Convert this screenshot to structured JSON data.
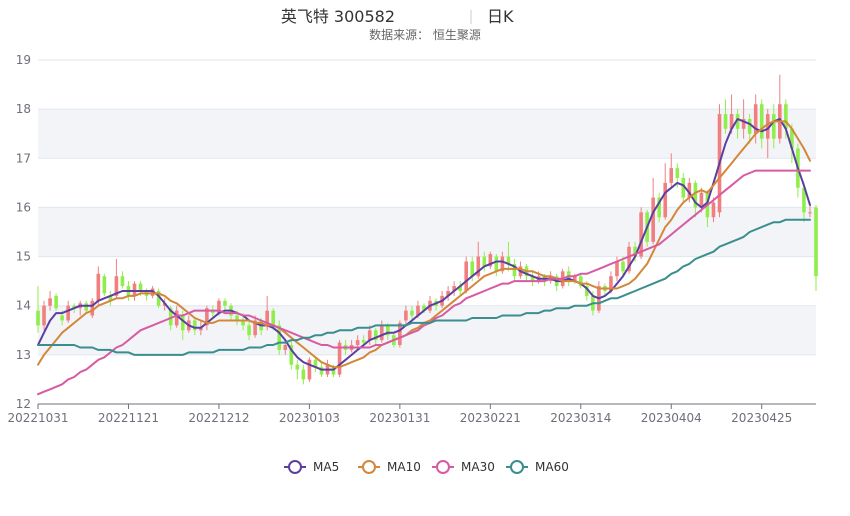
{
  "chart_data": {
    "type": "candlestick",
    "title": "英飞特 300582",
    "period_label": "日K",
    "subtitle": "数据来源： 恒生聚源",
    "ylim": [
      12,
      19
    ],
    "yticks": [
      12,
      13,
      14,
      15,
      16,
      17,
      18,
      19
    ],
    "x_tick_labels": [
      {
        "index": 0,
        "label": "20221031"
      },
      {
        "index": 15,
        "label": "20221121"
      },
      {
        "index": 30,
        "label": "20221212"
      },
      {
        "index": 45,
        "label": "20230103"
      },
      {
        "index": 60,
        "label": "20230131"
      },
      {
        "index": 75,
        "label": "20230221"
      },
      {
        "index": 90,
        "label": "20230314"
      },
      {
        "index": 105,
        "label": "20230404"
      },
      {
        "index": 120,
        "label": "20230425"
      }
    ],
    "up_color": "#F08080",
    "down_color": "#90EE4C",
    "grid": true,
    "legend_position": "bottom-center",
    "legend": [
      "MA5",
      "MA10",
      "MA30",
      "MA60"
    ],
    "candles": [
      [
        13.9,
        13.6,
        14.4,
        13.45
      ],
      [
        13.6,
        14.0,
        14.1,
        13.5
      ],
      [
        14.0,
        14.15,
        14.3,
        13.9
      ],
      [
        14.2,
        13.95,
        14.25,
        13.9
      ],
      [
        13.8,
        13.7,
        13.9,
        13.6
      ],
      [
        13.7,
        14.0,
        14.1,
        13.65
      ],
      [
        14.0,
        13.95,
        14.05,
        13.85
      ],
      [
        13.95,
        14.05,
        14.1,
        13.8
      ],
      [
        14.05,
        13.9,
        14.1,
        13.85
      ],
      [
        13.8,
        14.1,
        14.15,
        13.75
      ],
      [
        14.1,
        14.65,
        14.8,
        14.0
      ],
      [
        14.6,
        14.25,
        14.65,
        14.2
      ],
      [
        14.2,
        14.1,
        14.3,
        14.0
      ],
      [
        14.2,
        14.6,
        14.95,
        14.15
      ],
      [
        14.6,
        14.4,
        14.7,
        14.35
      ],
      [
        14.4,
        14.2,
        14.5,
        14.1
      ],
      [
        14.2,
        14.45,
        14.5,
        14.1
      ],
      [
        14.45,
        14.3,
        14.5,
        14.2
      ],
      [
        14.3,
        14.2,
        14.35,
        14.1
      ],
      [
        14.2,
        14.35,
        14.4,
        14.15
      ],
      [
        14.3,
        14.0,
        14.35,
        13.95
      ],
      [
        14.0,
        14.05,
        14.15,
        13.9
      ],
      [
        13.95,
        13.6,
        14.0,
        13.5
      ],
      [
        13.6,
        13.9,
        14.0,
        13.55
      ],
      [
        13.8,
        13.5,
        13.9,
        13.3
      ],
      [
        13.5,
        13.7,
        13.8,
        13.45
      ],
      [
        13.7,
        13.5,
        13.75,
        13.4
      ],
      [
        13.5,
        13.55,
        13.7,
        13.4
      ],
      [
        13.6,
        13.95,
        14.0,
        13.5
      ],
      [
        13.9,
        13.85,
        14.0,
        13.75
      ],
      [
        13.85,
        14.1,
        14.15,
        13.8
      ],
      [
        14.1,
        14.0,
        14.15,
        13.9
      ],
      [
        14.0,
        13.8,
        14.05,
        13.7
      ],
      [
        13.8,
        13.7,
        13.9,
        13.6
      ],
      [
        13.7,
        13.6,
        13.85,
        13.5
      ],
      [
        13.6,
        13.4,
        13.7,
        13.3
      ],
      [
        13.4,
        13.7,
        13.8,
        13.35
      ],
      [
        13.7,
        13.5,
        13.75,
        13.4
      ],
      [
        13.6,
        13.9,
        14.2,
        13.5
      ],
      [
        13.9,
        13.6,
        13.95,
        13.5
      ],
      [
        13.6,
        13.1,
        13.7,
        13.0
      ],
      [
        13.1,
        13.2,
        13.3,
        13.0
      ],
      [
        13.2,
        12.8,
        13.3,
        12.7
      ],
      [
        12.8,
        12.7,
        12.9,
        12.5
      ],
      [
        12.7,
        12.5,
        12.8,
        12.4
      ],
      [
        12.5,
        12.9,
        12.95,
        12.45
      ],
      [
        12.9,
        12.75,
        12.95,
        12.65
      ],
      [
        12.75,
        12.6,
        12.85,
        12.55
      ],
      [
        12.6,
        12.8,
        12.9,
        12.55
      ],
      [
        12.75,
        12.6,
        12.8,
        12.55
      ],
      [
        12.6,
        13.25,
        13.3,
        12.55
      ],
      [
        13.2,
        13.1,
        13.3,
        13.0
      ],
      [
        13.1,
        13.2,
        13.3,
        13.05
      ],
      [
        13.2,
        13.3,
        13.4,
        13.1
      ],
      [
        13.3,
        13.25,
        13.4,
        13.15
      ],
      [
        13.3,
        13.5,
        13.6,
        13.2
      ],
      [
        13.5,
        13.3,
        13.55,
        13.2
      ],
      [
        13.3,
        13.6,
        13.7,
        13.25
      ],
      [
        13.6,
        13.4,
        13.65,
        13.3
      ],
      [
        13.4,
        13.2,
        13.45,
        13.15
      ],
      [
        13.2,
        13.65,
        13.7,
        13.15
      ],
      [
        13.7,
        13.9,
        14.0,
        13.6
      ],
      [
        13.9,
        13.8,
        14.0,
        13.7
      ],
      [
        13.8,
        14.0,
        14.1,
        13.75
      ],
      [
        14.0,
        13.9,
        14.05,
        13.85
      ],
      [
        13.9,
        14.1,
        14.2,
        13.85
      ],
      [
        14.1,
        14.0,
        14.15,
        13.9
      ],
      [
        14.0,
        14.2,
        14.3,
        13.95
      ],
      [
        14.2,
        14.3,
        14.4,
        14.1
      ],
      [
        14.3,
        14.4,
        14.5,
        14.2
      ],
      [
        14.4,
        14.3,
        14.5,
        14.2
      ],
      [
        14.3,
        14.9,
        15.0,
        14.25
      ],
      [
        14.9,
        14.6,
        15.0,
        14.5
      ],
      [
        14.6,
        15.0,
        15.3,
        14.55
      ],
      [
        15.0,
        14.8,
        15.1,
        14.7
      ],
      [
        14.8,
        15.05,
        15.1,
        14.75
      ],
      [
        15.0,
        14.7,
        15.05,
        14.6
      ],
      [
        14.7,
        15.0,
        15.1,
        14.65
      ],
      [
        15.0,
        14.85,
        15.3,
        14.7
      ],
      [
        14.85,
        14.6,
        14.95,
        14.5
      ],
      [
        14.6,
        14.8,
        14.9,
        14.55
      ],
      [
        14.8,
        14.6,
        14.85,
        14.5
      ],
      [
        14.6,
        14.5,
        14.7,
        14.4
      ],
      [
        14.5,
        14.6,
        14.7,
        14.45
      ],
      [
        14.6,
        14.5,
        14.65,
        14.4
      ],
      [
        14.5,
        14.6,
        14.7,
        14.45
      ],
      [
        14.6,
        14.4,
        14.65,
        14.3
      ],
      [
        14.4,
        14.7,
        14.75,
        14.35
      ],
      [
        14.7,
        14.5,
        14.8,
        14.4
      ],
      [
        14.5,
        14.6,
        14.65,
        14.45
      ],
      [
        14.6,
        14.4,
        14.65,
        14.35
      ],
      [
        14.4,
        14.2,
        14.5,
        14.1
      ],
      [
        14.2,
        13.9,
        14.3,
        13.8
      ],
      [
        13.9,
        14.4,
        14.5,
        13.85
      ],
      [
        14.4,
        14.3,
        14.45,
        14.2
      ],
      [
        14.3,
        14.6,
        14.7,
        14.25
      ],
      [
        14.6,
        14.9,
        15.0,
        14.5
      ],
      [
        14.9,
        14.7,
        15.0,
        14.6
      ],
      [
        14.7,
        15.2,
        15.3,
        14.65
      ],
      [
        15.2,
        15.0,
        15.3,
        14.9
      ],
      [
        15.0,
        15.9,
        16.0,
        14.95
      ],
      [
        15.9,
        15.3,
        15.95,
        15.2
      ],
      [
        15.3,
        16.2,
        16.6,
        15.25
      ],
      [
        16.2,
        15.8,
        16.3,
        15.7
      ],
      [
        15.8,
        16.5,
        16.9,
        15.75
      ],
      [
        16.5,
        16.8,
        17.1,
        16.4
      ],
      [
        16.8,
        16.6,
        16.9,
        16.4
      ],
      [
        16.6,
        16.2,
        16.7,
        16.1
      ],
      [
        16.2,
        16.5,
        16.6,
        16.1
      ],
      [
        16.5,
        16.0,
        16.55,
        15.8
      ],
      [
        16.0,
        16.3,
        16.4,
        15.9
      ],
      [
        16.3,
        15.8,
        16.35,
        15.6
      ],
      [
        15.8,
        16.1,
        16.2,
        15.7
      ],
      [
        15.9,
        17.9,
        18.1,
        15.8
      ],
      [
        17.9,
        17.6,
        18.2,
        17.5
      ],
      [
        17.6,
        17.9,
        18.3,
        17.5
      ],
      [
        17.9,
        17.6,
        18.0,
        17.4
      ],
      [
        17.6,
        17.8,
        18.2,
        17.4
      ],
      [
        17.8,
        17.5,
        17.9,
        17.3
      ],
      [
        17.5,
        18.1,
        18.3,
        17.3
      ],
      [
        18.1,
        17.4,
        18.2,
        17.2
      ],
      [
        17.4,
        17.9,
        18.0,
        17.0
      ],
      [
        17.9,
        17.4,
        18.1,
        17.2
      ],
      [
        17.4,
        18.1,
        18.7,
        17.3
      ],
      [
        18.1,
        17.6,
        18.2,
        17.4
      ],
      [
        17.6,
        17.2,
        17.7,
        16.9
      ],
      [
        17.2,
        16.4,
        17.3,
        16.2
      ],
      [
        16.4,
        15.9,
        16.5,
        15.7
      ],
      [
        15.9,
        15.9,
        16.1,
        15.8
      ],
      [
        16.0,
        14.6,
        16.05,
        14.3
      ]
    ],
    "series": [
      {
        "name": "MA5",
        "color": "#5B3FA0",
        "values": [
          13.2,
          13.45,
          13.7,
          13.85,
          13.85,
          13.9,
          13.95,
          14.0,
          14.0,
          14.0,
          14.1,
          14.15,
          14.2,
          14.25,
          14.3,
          14.3,
          14.3,
          14.3,
          14.3,
          14.3,
          14.2,
          14.05,
          13.9,
          13.8,
          13.7,
          13.6,
          13.55,
          13.55,
          13.65,
          13.75,
          13.85,
          13.9,
          13.9,
          13.85,
          13.8,
          13.7,
          13.65,
          13.6,
          13.6,
          13.55,
          13.45,
          13.3,
          13.1,
          12.95,
          12.85,
          12.8,
          12.75,
          12.7,
          12.7,
          12.7,
          12.8,
          12.9,
          13.0,
          13.1,
          13.2,
          13.3,
          13.35,
          13.4,
          13.45,
          13.45,
          13.5,
          13.6,
          13.7,
          13.8,
          13.9,
          14.0,
          14.05,
          14.1,
          14.2,
          14.3,
          14.4,
          14.5,
          14.6,
          14.7,
          14.8,
          14.85,
          14.9,
          14.9,
          14.85,
          14.8,
          14.7,
          14.65,
          14.6,
          14.55,
          14.55,
          14.55,
          14.5,
          14.5,
          14.55,
          14.5,
          14.45,
          14.35,
          14.2,
          14.15,
          14.2,
          14.3,
          14.45,
          14.6,
          14.8,
          15.0,
          15.3,
          15.6,
          15.9,
          16.1,
          16.3,
          16.4,
          16.5,
          16.45,
          16.3,
          16.1,
          16.0,
          16.1,
          16.5,
          16.9,
          17.3,
          17.6,
          17.8,
          17.75,
          17.7,
          17.6,
          17.55,
          17.6,
          17.75,
          17.8,
          17.6,
          17.2,
          16.8,
          16.45,
          16.05
        ]
      },
      {
        "name": "MA10",
        "color": "#D4873A",
        "values": [
          12.8,
          13.0,
          13.15,
          13.3,
          13.45,
          13.55,
          13.65,
          13.75,
          13.85,
          13.9,
          14.0,
          14.05,
          14.1,
          14.15,
          14.15,
          14.2,
          14.2,
          14.25,
          14.25,
          14.25,
          14.25,
          14.2,
          14.1,
          14.05,
          13.95,
          13.85,
          13.75,
          13.7,
          13.65,
          13.65,
          13.7,
          13.7,
          13.7,
          13.7,
          13.7,
          13.7,
          13.65,
          13.65,
          13.6,
          13.6,
          13.55,
          13.45,
          13.35,
          13.25,
          13.15,
          13.05,
          12.95,
          12.85,
          12.8,
          12.75,
          12.75,
          12.8,
          12.85,
          12.9,
          12.95,
          13.05,
          13.1,
          13.2,
          13.25,
          13.3,
          13.35,
          13.4,
          13.5,
          13.55,
          13.65,
          13.7,
          13.8,
          13.9,
          14.0,
          14.1,
          14.2,
          14.3,
          14.4,
          14.5,
          14.6,
          14.65,
          14.7,
          14.75,
          14.75,
          14.75,
          14.75,
          14.7,
          14.7,
          14.65,
          14.6,
          14.6,
          14.55,
          14.5,
          14.5,
          14.5,
          14.45,
          14.45,
          14.4,
          14.35,
          14.35,
          14.35,
          14.35,
          14.4,
          14.45,
          14.55,
          14.7,
          14.85,
          15.1,
          15.35,
          15.6,
          15.75,
          15.95,
          16.1,
          16.2,
          16.3,
          16.35,
          16.3,
          16.45,
          16.6,
          16.75,
          16.9,
          17.05,
          17.2,
          17.35,
          17.5,
          17.6,
          17.7,
          17.75,
          17.75,
          17.75,
          17.6,
          17.4,
          17.2,
          16.95
        ]
      },
      {
        "name": "MA30",
        "color": "#D65BA3",
        "values": [
          12.2,
          12.25,
          12.3,
          12.35,
          12.4,
          12.5,
          12.55,
          12.65,
          12.7,
          12.8,
          12.9,
          12.95,
          13.05,
          13.15,
          13.2,
          13.3,
          13.4,
          13.5,
          13.55,
          13.6,
          13.65,
          13.7,
          13.75,
          13.8,
          13.8,
          13.85,
          13.9,
          13.9,
          13.9,
          13.9,
          13.9,
          13.85,
          13.85,
          13.85,
          13.8,
          13.8,
          13.75,
          13.7,
          13.65,
          13.6,
          13.55,
          13.5,
          13.45,
          13.4,
          13.35,
          13.3,
          13.25,
          13.2,
          13.2,
          13.15,
          13.15,
          13.15,
          13.15,
          13.15,
          13.15,
          13.15,
          13.2,
          13.2,
          13.25,
          13.3,
          13.35,
          13.4,
          13.45,
          13.5,
          13.6,
          13.65,
          13.75,
          13.8,
          13.9,
          14.0,
          14.05,
          14.15,
          14.2,
          14.25,
          14.3,
          14.35,
          14.4,
          14.45,
          14.45,
          14.5,
          14.5,
          14.5,
          14.5,
          14.5,
          14.5,
          14.55,
          14.55,
          14.55,
          14.6,
          14.6,
          14.65,
          14.65,
          14.7,
          14.75,
          14.8,
          14.85,
          14.9,
          14.95,
          15.0,
          15.05,
          15.1,
          15.15,
          15.2,
          15.25,
          15.35,
          15.45,
          15.55,
          15.65,
          15.75,
          15.85,
          15.95,
          16.05,
          16.15,
          16.25,
          16.35,
          16.45,
          16.55,
          16.65,
          16.7,
          16.75,
          16.75,
          16.75,
          16.75,
          16.75,
          16.75,
          16.75,
          16.75,
          16.75,
          16.75
        ]
      },
      {
        "name": "MA60",
        "color": "#3A8E8E",
        "values": [
          13.2,
          13.2,
          13.2,
          13.2,
          13.2,
          13.2,
          13.2,
          13.15,
          13.15,
          13.15,
          13.1,
          13.1,
          13.1,
          13.05,
          13.05,
          13.05,
          13.0,
          13.0,
          13.0,
          13.0,
          13.0,
          13.0,
          13.0,
          13.0,
          13.0,
          13.05,
          13.05,
          13.05,
          13.05,
          13.05,
          13.1,
          13.1,
          13.1,
          13.1,
          13.1,
          13.15,
          13.15,
          13.15,
          13.2,
          13.2,
          13.25,
          13.25,
          13.3,
          13.3,
          13.35,
          13.35,
          13.4,
          13.4,
          13.45,
          13.45,
          13.5,
          13.5,
          13.5,
          13.55,
          13.55,
          13.55,
          13.6,
          13.6,
          13.6,
          13.6,
          13.6,
          13.6,
          13.65,
          13.65,
          13.65,
          13.65,
          13.7,
          13.7,
          13.7,
          13.7,
          13.7,
          13.7,
          13.75,
          13.75,
          13.75,
          13.75,
          13.75,
          13.8,
          13.8,
          13.8,
          13.8,
          13.85,
          13.85,
          13.85,
          13.9,
          13.9,
          13.95,
          13.95,
          13.95,
          14.0,
          14.0,
          14.0,
          14.05,
          14.05,
          14.1,
          14.15,
          14.15,
          14.2,
          14.25,
          14.3,
          14.35,
          14.4,
          14.45,
          14.5,
          14.55,
          14.65,
          14.7,
          14.8,
          14.85,
          14.95,
          15.0,
          15.05,
          15.1,
          15.2,
          15.25,
          15.3,
          15.35,
          15.4,
          15.5,
          15.55,
          15.6,
          15.65,
          15.7,
          15.7,
          15.75,
          15.75,
          15.75,
          15.75,
          15.75
        ]
      }
    ]
  }
}
